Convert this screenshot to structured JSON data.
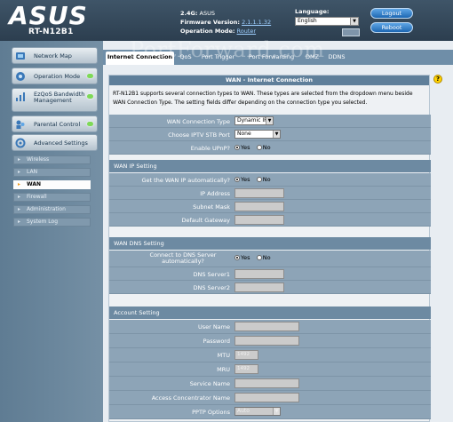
{
  "header": {
    "brand": "ASUS",
    "model": "RT-N12B1",
    "band_label": "2.4G:",
    "band_value": "ASUS",
    "firmware_label": "Firmware Version:",
    "firmware_value": "2.1.1.1.32",
    "opmode_label": "Operation Mode:",
    "opmode_value": "Router",
    "language_label": "Language:",
    "language_value": "English",
    "logout": "Logout",
    "reboot": "Reboot"
  },
  "sidebar": {
    "items": [
      {
        "label": "Network Map",
        "icon": "network-map-icon"
      },
      {
        "label": "Operation Mode",
        "icon": "operation-mode-icon"
      },
      {
        "label": "EzQoS Bandwidth Management",
        "icon": "ezqos-icon"
      },
      {
        "label": "Parental Control",
        "icon": "parental-control-icon"
      },
      {
        "label": "Advanced Settings",
        "icon": "advanced-settings-icon"
      }
    ],
    "subitems": [
      {
        "label": "Wireless"
      },
      {
        "label": "LAN"
      },
      {
        "label": "WAN"
      },
      {
        "label": "Firewall"
      },
      {
        "label": "Administration"
      },
      {
        "label": "System Log"
      }
    ]
  },
  "tabs": [
    {
      "label": "Internet Connection"
    },
    {
      "label": "QoS"
    },
    {
      "label": "Port Trigger"
    },
    {
      "label": "Port Forwarding"
    },
    {
      "label": "DMZ"
    },
    {
      "label": "DDNS"
    }
  ],
  "watermark": "PortForward.com",
  "panel": {
    "title": "WAN - Internet Connection",
    "description": "RT-N12B1 supports several connection types to WAN. These types are selected from the dropdown menu beside WAN Connection Type. The setting fields differ depending on the connection type you selected.",
    "general": {
      "wan_type_label": "WAN Connection Type",
      "wan_type_value": "Dynamic IP",
      "iptv_label": "Choose IPTV STB Port",
      "iptv_value": "None",
      "upnp_label": "Enable UPnP?",
      "yes": "Yes",
      "no": "No"
    },
    "wan_ip": {
      "heading": "WAN IP Setting",
      "auto_label": "Get the WAN IP automatically?",
      "ip_label": "IP Address",
      "mask_label": "Subnet Mask",
      "gateway_label": "Default Gateway"
    },
    "wan_dns": {
      "heading": "WAN DNS Setting",
      "auto_label": "Connect to DNS Server automatically?",
      "dns1_label": "DNS Server1",
      "dns2_label": "DNS Server2"
    },
    "account": {
      "heading": "Account Setting",
      "user_label": "User Name",
      "pass_label": "Password",
      "mtu_label": "MTU",
      "mtu_value": "1492",
      "mru_label": "MRU",
      "mru_value": "1492",
      "service_label": "Service Name",
      "ac_label": "Access Concentrator Name",
      "pptp_label": "PPTP Options",
      "pptp_value": "Auto"
    }
  },
  "colors": {
    "header_bg": "#2c3e4f",
    "sidebar_bg": "#6a869c",
    "panel_title_bg": "#5f7f9a",
    "row_bg": "#8da4b7",
    "accent_button": "#1d67b2"
  }
}
